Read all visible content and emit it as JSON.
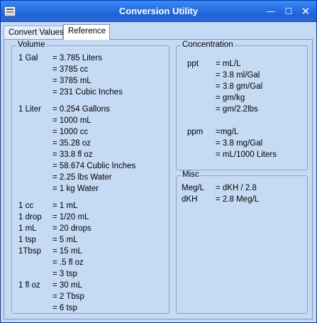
{
  "window": {
    "title": "Conversion Utility",
    "minimize_glyph": "—",
    "maximize_glyph": "☐",
    "close_glyph": "✕",
    "icon": "app-calculator-icon"
  },
  "tabs": [
    {
      "label": "Convert Values",
      "selected": false
    },
    {
      "label": "Reference",
      "selected": true
    }
  ],
  "volume": {
    "legend": "Volume",
    "rows": [
      {
        "unit": "1 Gal",
        "value": "= 3.785 Liters"
      },
      {
        "unit": "",
        "value": "= 3785 cc"
      },
      {
        "unit": "",
        "value": "= 3785 mL"
      },
      {
        "unit": "",
        "value": "= 231 Cubic Inches"
      },
      {
        "unit": "1 Liter",
        "value": "= 0.254 Gallons"
      },
      {
        "unit": "",
        "value": "= 1000 mL"
      },
      {
        "unit": "",
        "value": "= 1000 cc"
      },
      {
        "unit": "",
        "value": "= 35.28 oz"
      },
      {
        "unit": "",
        "value": "= 33.8 fl oz"
      },
      {
        "unit": "",
        "value": "= 58.674 Cublic Inches"
      },
      {
        "unit": "",
        "value": "= 2.25 lbs Water"
      },
      {
        "unit": "",
        "value": "= 1 kg Water"
      },
      {
        "unit": "1 cc",
        "value": "= 1 mL"
      },
      {
        "unit": "1 drop",
        "value": "= 1/20 mL"
      },
      {
        "unit": "1 mL",
        "value": "= 20 drops"
      },
      {
        "unit": "1 tsp",
        "value": "= 5 mL"
      },
      {
        "unit": "1Tbsp",
        "value": "= 15 mL"
      },
      {
        "unit": "",
        "value": "= .5 fl oz"
      },
      {
        "unit": "",
        "value": "= 3 tsp"
      },
      {
        "unit": "1 fl oz",
        "value": "= 30 mL"
      },
      {
        "unit": "",
        "value": "= 2 Tbsp"
      },
      {
        "unit": "",
        "value": "= 6 tsp"
      }
    ]
  },
  "concentration": {
    "legend": "Concentration",
    "rows": [
      {
        "unit": "ppt",
        "value": "= mL/L"
      },
      {
        "unit": "",
        "value": "= 3.8 ml/Gal"
      },
      {
        "unit": "",
        "value": "= 3.8 gm/Gal"
      },
      {
        "unit": "",
        "value": "= gm/kg"
      },
      {
        "unit": "",
        "value": "= gm/2.2lbs"
      },
      {
        "unit": "ppm",
        "value": "=mg/L"
      },
      {
        "unit": "",
        "value": "= 3.8 mg/Gal"
      },
      {
        "unit": "",
        "value": "= mL/1000 Liters"
      }
    ]
  },
  "misc": {
    "legend": "Misc",
    "rows": [
      {
        "unit": "Meg/L",
        "value": "= dKH / 2.8"
      },
      {
        "unit": "dKH",
        "value": "= 2.8  Meg/L"
      }
    ]
  }
}
